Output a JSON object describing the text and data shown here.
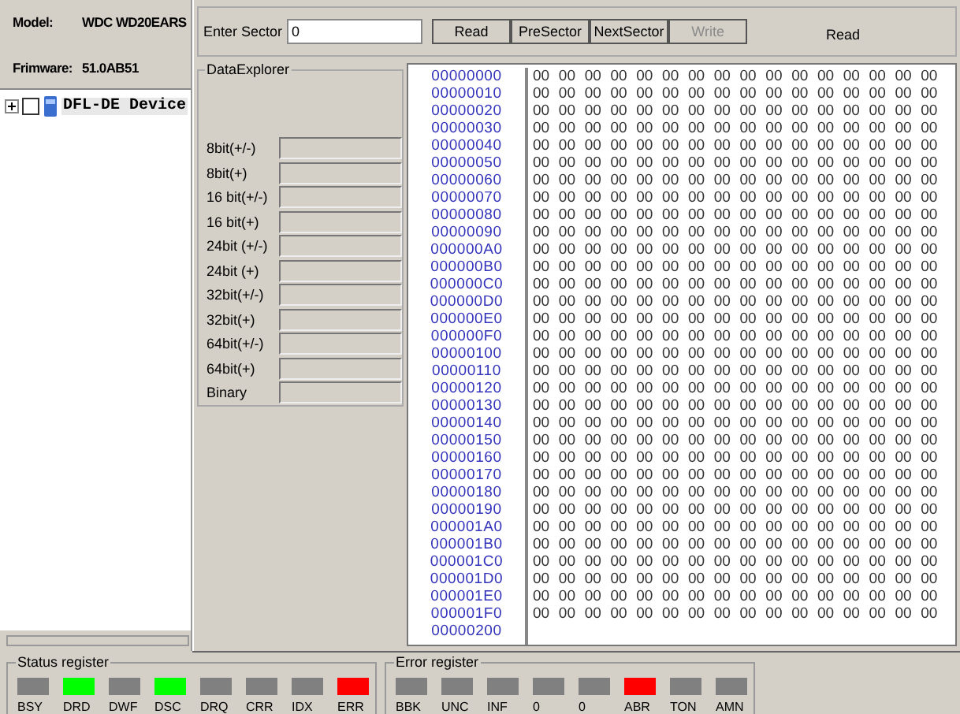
{
  "disk_info": {
    "model_label": "Model:",
    "model_value": "WDC WD20EARS",
    "firmware_label": "Frimware:",
    "firmware_value": "51.0AB51"
  },
  "progress": {
    "level": 0
  },
  "device_tree": [
    {
      "label": "DFL-DE Device",
      "expanded": false,
      "checked": false
    }
  ],
  "status_register": {
    "title": "Status register",
    "bits": [
      {
        "label": "BSY",
        "color": "#808080"
      },
      {
        "label": "DRD",
        "color": "#00ff00"
      },
      {
        "label": "DWF",
        "color": "#808080"
      },
      {
        "label": "DSC",
        "color": "#00ff00"
      },
      {
        "label": "DRQ",
        "color": "#808080"
      },
      {
        "label": "CRR",
        "color": "#808080"
      },
      {
        "label": "IDX",
        "color": "#808080"
      },
      {
        "label": "ERR",
        "color": "#ff0000"
      }
    ]
  },
  "error_register": {
    "title": "Error register",
    "bits": [
      {
        "label": "BBK",
        "color": "#808080"
      },
      {
        "label": "UNC",
        "color": "#808080"
      },
      {
        "label": "INF",
        "color": "#808080"
      },
      {
        "label": "0",
        "color": "#808080"
      },
      {
        "label": "0",
        "color": "#808080"
      },
      {
        "label": "ABR",
        "color": "#ff0000"
      },
      {
        "label": "TON",
        "color": "#808080"
      },
      {
        "label": "AMN",
        "color": "#808080"
      }
    ]
  },
  "sector_editor": {
    "sector_label": "Enter Sector",
    "sector_value": "0",
    "buttons": [
      {
        "label": "Read",
        "disabled": false
      },
      {
        "label": "PreSector",
        "disabled": false
      },
      {
        "label": "NextSector",
        "disabled": false
      },
      {
        "label": "Write",
        "disabled": true
      }
    ],
    "status_text": "Read",
    "data_explorer": {
      "title": "DataExplorer",
      "fields": [
        {
          "label": "8bit(+/-)"
        },
        {
          "label": "8bit(+)"
        },
        {
          "label": "16 bit(+/-)"
        },
        {
          "label": "16 bit(+)"
        },
        {
          "label": "24bit (+/-)"
        },
        {
          "label": "24bit (+)"
        },
        {
          "label": "32bit(+/-)"
        },
        {
          "label": "32bit(+)"
        },
        {
          "label": "64bit(+/-)"
        },
        {
          "label": "64bit(+)"
        },
        {
          "label": "Binary"
        }
      ]
    },
    "hex_rows": [
      {
        "address": "00000000",
        "bytes": "00 00 00 00 00 00 00 00 00 00 00 00 00 00 00 00"
      },
      {
        "address": "00000010",
        "bytes": "00 00 00 00 00 00 00 00 00 00 00 00 00 00 00 00"
      },
      {
        "address": "00000020",
        "bytes": "00 00 00 00 00 00 00 00 00 00 00 00 00 00 00 00"
      },
      {
        "address": "00000030",
        "bytes": "00 00 00 00 00 00 00 00 00 00 00 00 00 00 00 00"
      },
      {
        "address": "00000040",
        "bytes": "00 00 00 00 00 00 00 00 00 00 00 00 00 00 00 00"
      },
      {
        "address": "00000050",
        "bytes": "00 00 00 00 00 00 00 00 00 00 00 00 00 00 00 00"
      },
      {
        "address": "00000060",
        "bytes": "00 00 00 00 00 00 00 00 00 00 00 00 00 00 00 00"
      },
      {
        "address": "00000070",
        "bytes": "00 00 00 00 00 00 00 00 00 00 00 00 00 00 00 00"
      },
      {
        "address": "00000080",
        "bytes": "00 00 00 00 00 00 00 00 00 00 00 00 00 00 00 00"
      },
      {
        "address": "00000090",
        "bytes": "00 00 00 00 00 00 00 00 00 00 00 00 00 00 00 00"
      },
      {
        "address": "000000A0",
        "bytes": "00 00 00 00 00 00 00 00 00 00 00 00 00 00 00 00"
      },
      {
        "address": "000000B0",
        "bytes": "00 00 00 00 00 00 00 00 00 00 00 00 00 00 00 00"
      },
      {
        "address": "000000C0",
        "bytes": "00 00 00 00 00 00 00 00 00 00 00 00 00 00 00 00"
      },
      {
        "address": "000000D0",
        "bytes": "00 00 00 00 00 00 00 00 00 00 00 00 00 00 00 00"
      },
      {
        "address": "000000E0",
        "bytes": "00 00 00 00 00 00 00 00 00 00 00 00 00 00 00 00"
      },
      {
        "address": "000000F0",
        "bytes": "00 00 00 00 00 00 00 00 00 00 00 00 00 00 00 00"
      },
      {
        "address": "00000100",
        "bytes": "00 00 00 00 00 00 00 00 00 00 00 00 00 00 00 00"
      },
      {
        "address": "00000110",
        "bytes": "00 00 00 00 00 00 00 00 00 00 00 00 00 00 00 00"
      },
      {
        "address": "00000120",
        "bytes": "00 00 00 00 00 00 00 00 00 00 00 00 00 00 00 00"
      },
      {
        "address": "00000130",
        "bytes": "00 00 00 00 00 00 00 00 00 00 00 00 00 00 00 00"
      },
      {
        "address": "00000140",
        "bytes": "00 00 00 00 00 00 00 00 00 00 00 00 00 00 00 00"
      },
      {
        "address": "00000150",
        "bytes": "00 00 00 00 00 00 00 00 00 00 00 00 00 00 00 00"
      },
      {
        "address": "00000160",
        "bytes": "00 00 00 00 00 00 00 00 00 00 00 00 00 00 00 00"
      },
      {
        "address": "00000170",
        "bytes": "00 00 00 00 00 00 00 00 00 00 00 00 00 00 00 00"
      },
      {
        "address": "00000180",
        "bytes": "00 00 00 00 00 00 00 00 00 00 00 00 00 00 00 00"
      },
      {
        "address": "00000190",
        "bytes": "00 00 00 00 00 00 00 00 00 00 00 00 00 00 00 00"
      },
      {
        "address": "000001A0",
        "bytes": "00 00 00 00 00 00 00 00 00 00 00 00 00 00 00 00"
      },
      {
        "address": "000001B0",
        "bytes": "00 00 00 00 00 00 00 00 00 00 00 00 00 00 00 00"
      },
      {
        "address": "000001C0",
        "bytes": "00 00 00 00 00 00 00 00 00 00 00 00 00 00 00 00"
      },
      {
        "address": "000001D0",
        "bytes": "00 00 00 00 00 00 00 00 00 00 00 00 00 00 00 00"
      },
      {
        "address": "000001E0",
        "bytes": "00 00 00 00 00 00 00 00 00 00 00 00 00 00 00 00"
      },
      {
        "address": "000001F0",
        "bytes": "00 00 00 00 00 00 00 00 00 00 00 00 00 00 00 00"
      },
      {
        "address": "00000200"
      }
    ]
  }
}
